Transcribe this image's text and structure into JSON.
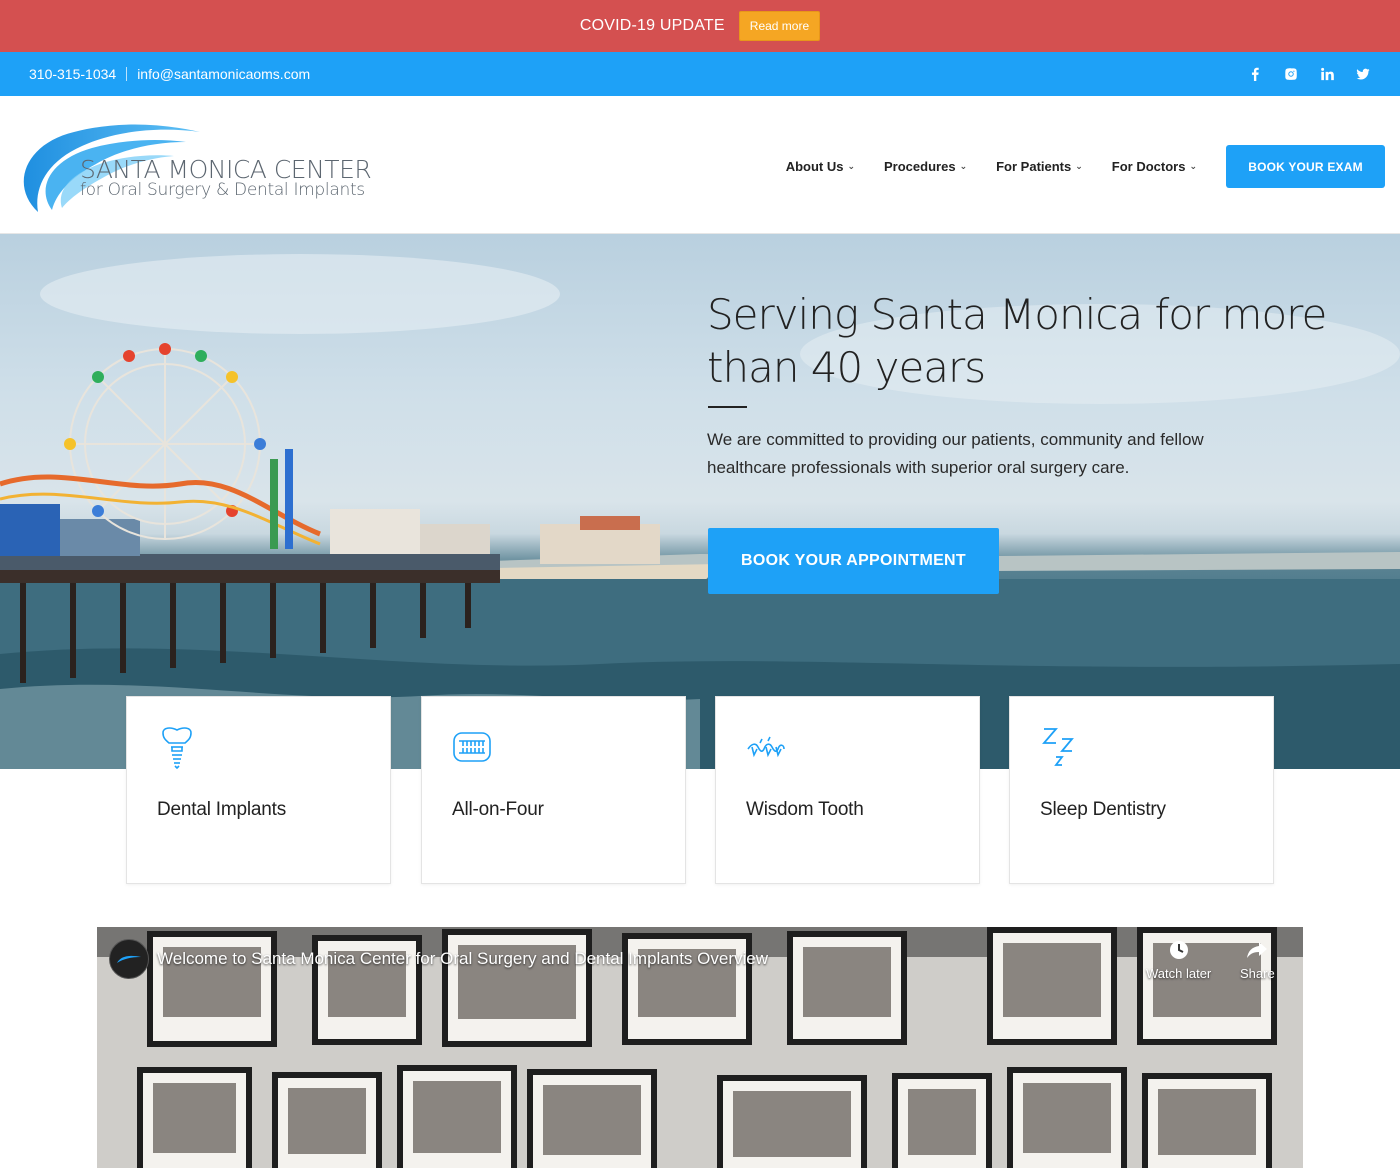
{
  "covid": {
    "title": "COVID-19 UPDATE",
    "button": "Read more"
  },
  "contact": {
    "phone": "310-315-1034",
    "email": "info@santamonicaoms.com"
  },
  "social": [
    "facebook-icon",
    "instagram-icon",
    "linkedin-icon",
    "twitter-icon"
  ],
  "logo": {
    "line1": "SANTA MONICA CENTER",
    "line2": "for Oral Surgery & Dental Implants"
  },
  "nav": {
    "items": [
      {
        "label": "About Us"
      },
      {
        "label": "Procedures"
      },
      {
        "label": "For Patients"
      },
      {
        "label": "For Doctors"
      }
    ],
    "cta": "BOOK YOUR EXAM"
  },
  "hero": {
    "title": "Serving Santa Monica for more than 40 years",
    "text": "We are committed to providing our patients, community and fellow healthcare professionals with superior oral surgery care.",
    "button": "BOOK YOUR APPOINTMENT"
  },
  "services": [
    {
      "label": "Dental Implants",
      "icon": "dental-implant-icon"
    },
    {
      "label": "All-on-Four",
      "icon": "dentures-icon"
    },
    {
      "label": "Wisdom Tooth",
      "icon": "wisdom-tooth-icon"
    },
    {
      "label": "Sleep Dentistry",
      "icon": "sleep-zzz-icon"
    }
  ],
  "video": {
    "title": "Welcome to Santa Monica Center for Oral Surgery and Dental Implants Overview",
    "watch_later": "Watch later",
    "share": "Share"
  },
  "colors": {
    "covid_bar": "#d45050",
    "accent": "#1ea1f7",
    "read_more": "#f5a623"
  }
}
